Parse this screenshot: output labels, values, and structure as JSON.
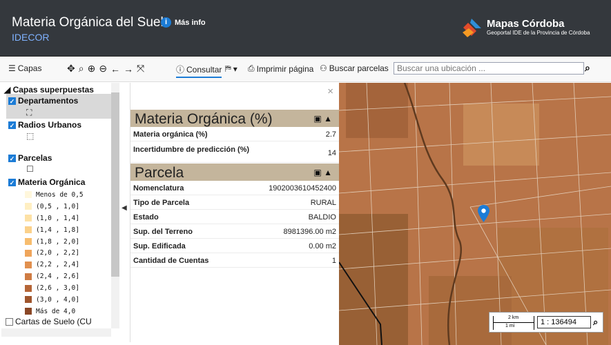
{
  "header": {
    "title": "Materia Orgánica del Suelo",
    "subtitle": "IDECOR",
    "info_label": "Más info",
    "brand_name": "Mapas Córdoba",
    "brand_sub": "Geoportal IDE de la Provincia de Córdoba"
  },
  "toolbar": {
    "capas": "Capas",
    "consultar": "Consultar",
    "imprimir": "Imprimir página",
    "buscar_parcelas": "Buscar parcelas",
    "search_placeholder": "Buscar una ubicación ..."
  },
  "sidebar": {
    "root": "Capas superpuestas",
    "layers": [
      {
        "label": "Departamentos",
        "checked": true
      },
      {
        "label": "Radios Urbanos",
        "checked": true
      },
      {
        "label": "Parcelas",
        "checked": true
      },
      {
        "label": "Materia Orgánica",
        "checked": true
      }
    ],
    "legend": [
      {
        "label": "Menos de 0,5",
        "color": "#fff7dc"
      },
      {
        "label": "(0,5 , 1,0]",
        "color": "#ffefc2"
      },
      {
        "label": "(1,0 , 1,4]",
        "color": "#fde1a5"
      },
      {
        "label": "(1,4 , 1,8]",
        "color": "#fbd18a"
      },
      {
        "label": "(1,8 , 2,0]",
        "color": "#f7bd6e"
      },
      {
        "label": "(2,0 , 2,2]",
        "color": "#efa55b"
      },
      {
        "label": "(2,2 , 2,4]",
        "color": "#e1904f"
      },
      {
        "label": "(2,4 , 2,6]",
        "color": "#cf7b43"
      },
      {
        "label": "(2,6 , 3,0]",
        "color": "#b56537"
      },
      {
        "label": "(3,0 , 4,0]",
        "color": "#9f552d"
      },
      {
        "label": "Más de 4,0",
        "color": "#8a4726"
      }
    ],
    "cartas": "Cartas de Suelo (CU"
  },
  "panel": {
    "section1": "Materia Orgánica (%)",
    "rows1": [
      {
        "key": "Materia orgánica (%)",
        "value": "2.7"
      },
      {
        "key": "Incertidumbre de predicción (%)",
        "value": "14"
      }
    ],
    "section2": "Parcela",
    "rows2": [
      {
        "key": "Nomenclatura",
        "value": "1902003610452400"
      },
      {
        "key": "Tipo de Parcela",
        "value": "RURAL"
      },
      {
        "key": "Estado",
        "value": "BALDIO"
      },
      {
        "key": "Sup. del Terreno",
        "value": "8981396.00 m2"
      },
      {
        "key": "Sup. Edificada",
        "value": "0.00 m2"
      },
      {
        "key": "Cantidad de Cuentas",
        "value": "1"
      }
    ]
  },
  "map": {
    "scale_km": "2 km",
    "scale_mi": "1 mi",
    "scale_value": "1 : 136494"
  }
}
